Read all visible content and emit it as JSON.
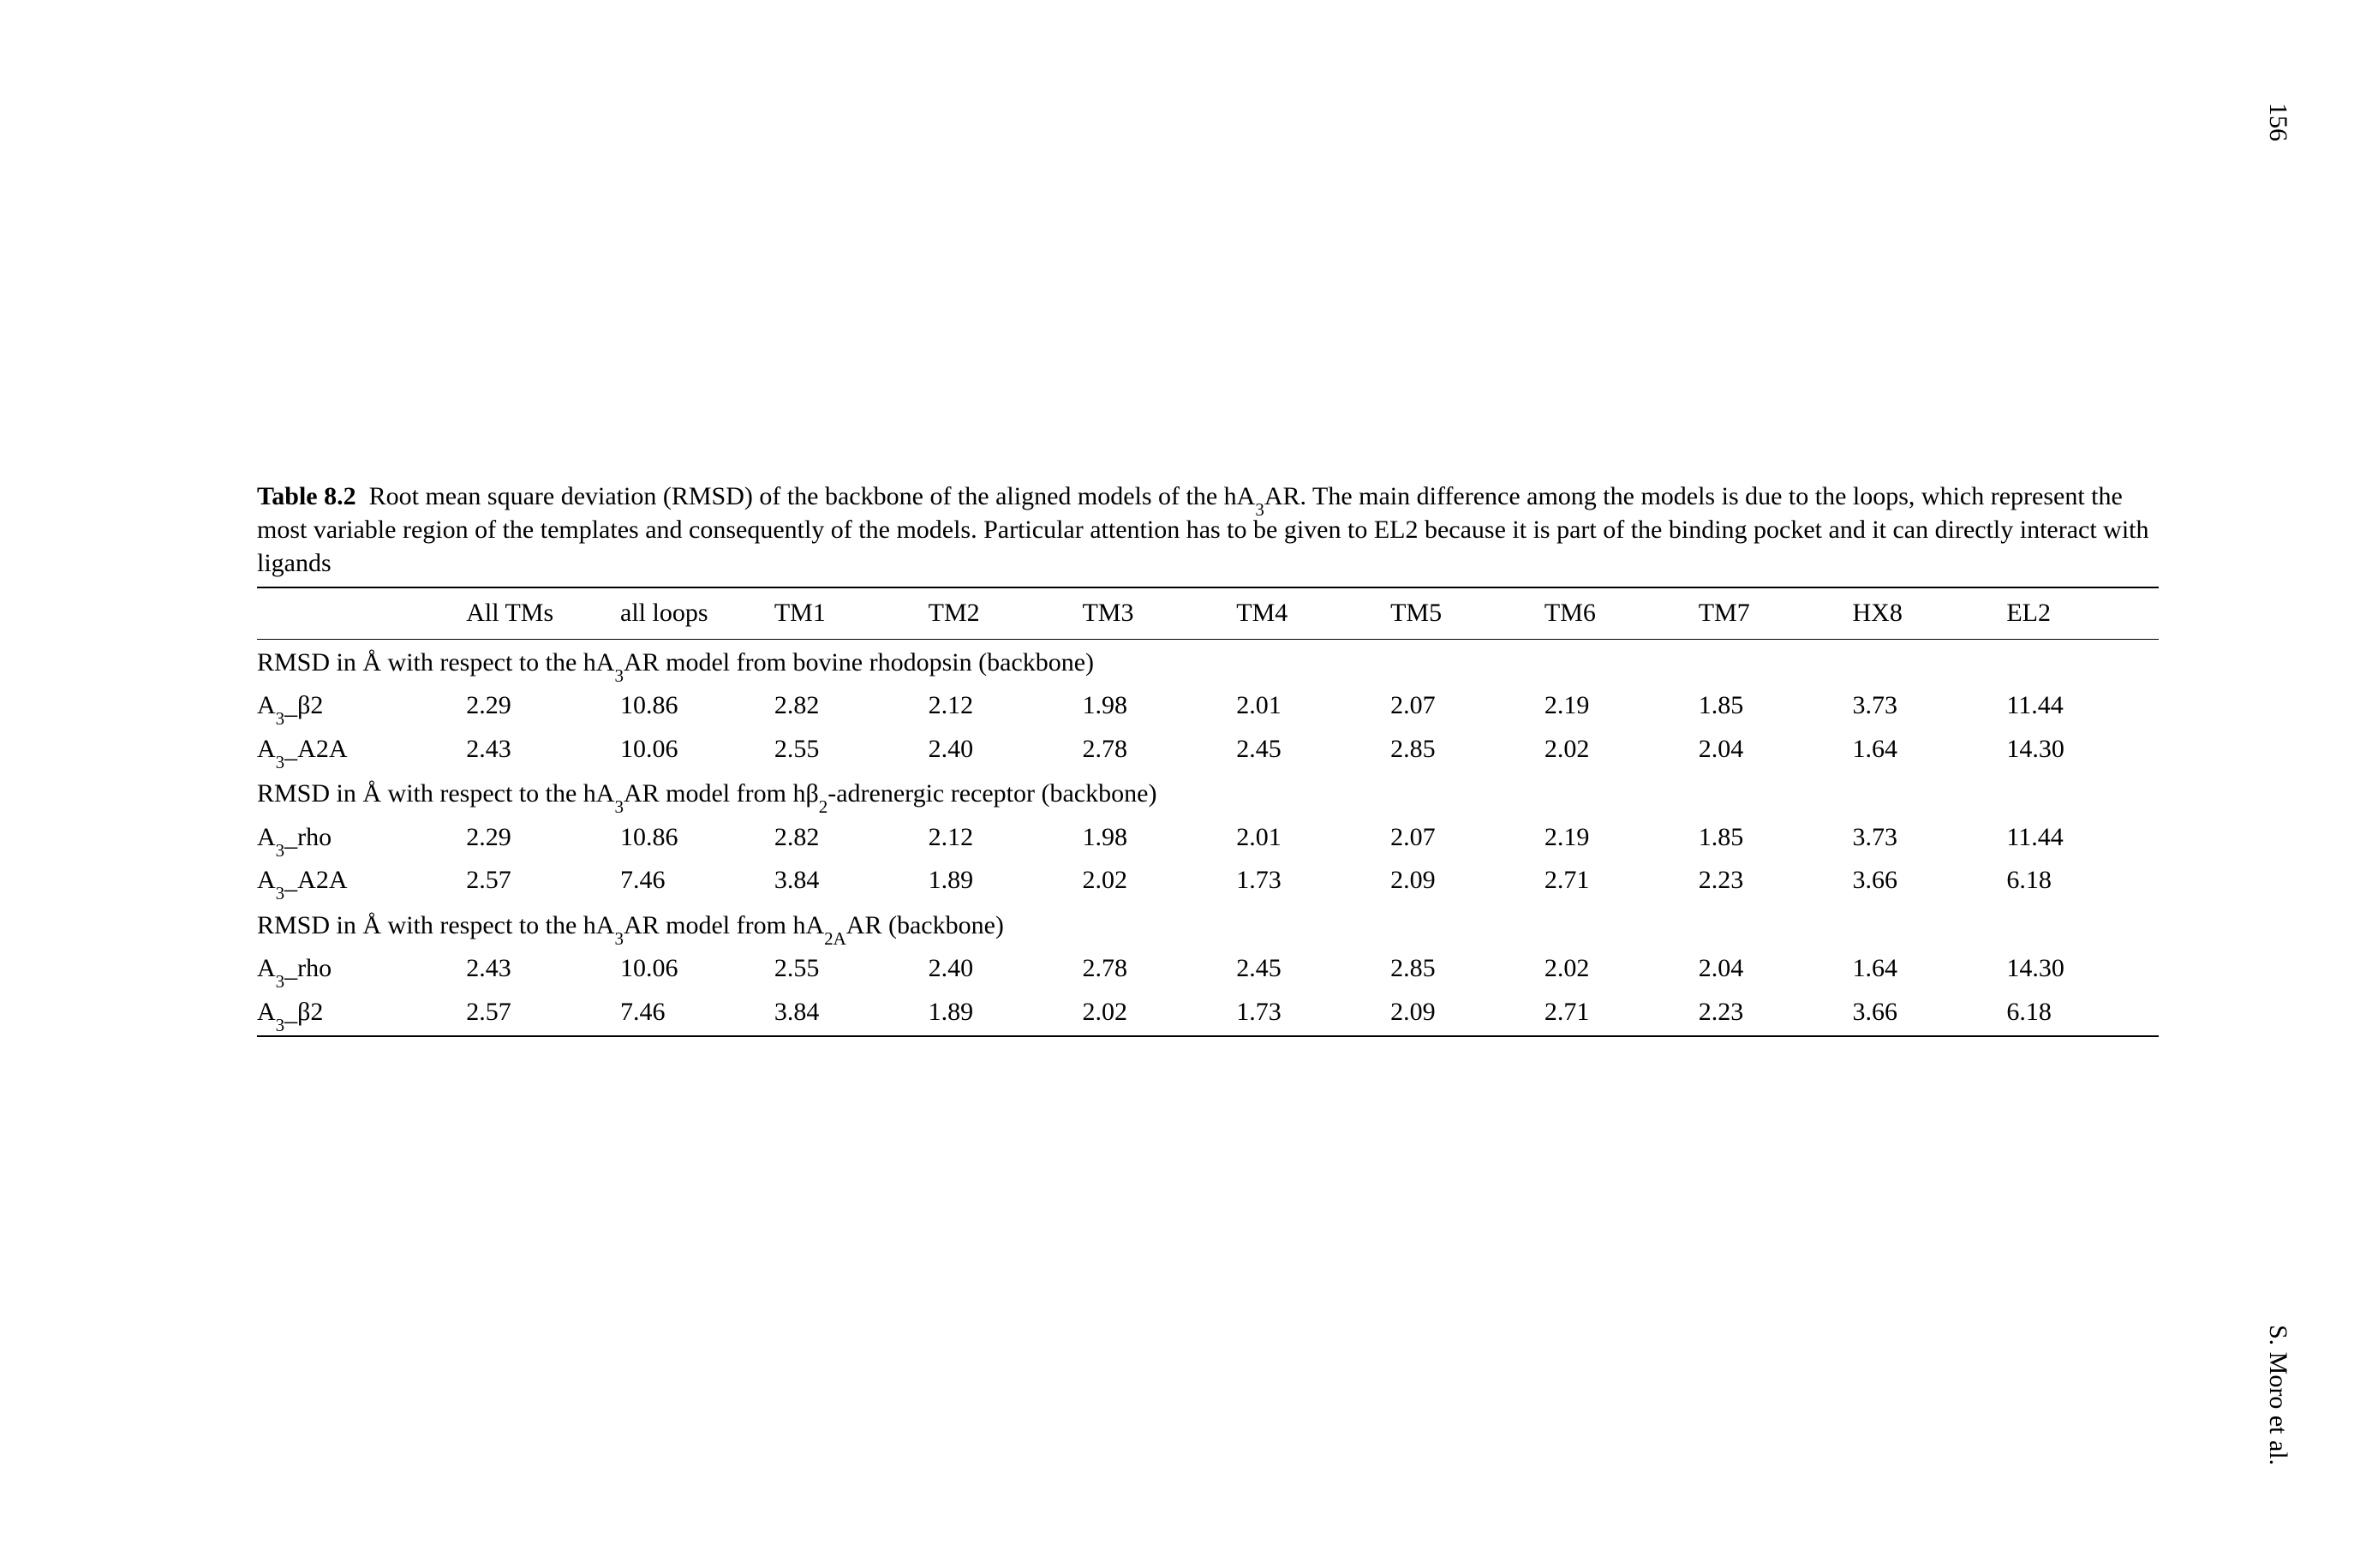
{
  "page_number": "156",
  "author": "S. Moro et al.",
  "caption_label": "Table 8.2",
  "caption_text": "Root mean square deviation (RMSD) of the backbone of the aligned models of the hA₃AR. The main difference among the models is due to the loops, which represent the most variable region of the templates and consequently of the models. Particular attention has to be given to EL2 because it is part of the binding pocket and it can directly interact with ligands",
  "headers": [
    "",
    "All TMs",
    "all loops",
    "TM1",
    "TM2",
    "TM3",
    "TM4",
    "TM5",
    "TM6",
    "TM7",
    "HX8",
    "EL2"
  ],
  "sections": [
    {
      "title": "RMSD in Å with respect to the hA₃AR model from bovine rhodopsin (backbone)",
      "rows": [
        {
          "label": "A₃_β2",
          "vals": [
            "2.29",
            "10.86",
            "2.82",
            "2.12",
            "1.98",
            "2.01",
            "2.07",
            "2.19",
            "1.85",
            "3.73",
            "11.44"
          ]
        },
        {
          "label": "A₃_A2A",
          "vals": [
            "2.43",
            "10.06",
            "2.55",
            "2.40",
            "2.78",
            "2.45",
            "2.85",
            "2.02",
            "2.04",
            "1.64",
            "14.30"
          ]
        }
      ]
    },
    {
      "title": "RMSD in Å with respect to the hA₃AR model from hβ₂-adrenergic receptor (backbone)",
      "rows": [
        {
          "label": "A₃_rho",
          "vals": [
            "2.29",
            "10.86",
            "2.82",
            "2.12",
            "1.98",
            "2.01",
            "2.07",
            "2.19",
            "1.85",
            "3.73",
            "11.44"
          ]
        },
        {
          "label": "A₃_A2A",
          "vals": [
            "2.57",
            "7.46",
            "3.84",
            "1.89",
            "2.02",
            "1.73",
            "2.09",
            "2.71",
            "2.23",
            "3.66",
            "6.18"
          ]
        }
      ]
    },
    {
      "title": "RMSD in Å with respect to the hA₃AR model from hA₂ₐAR (backbone)",
      "rows": [
        {
          "label": "A₃_rho",
          "vals": [
            "2.43",
            "10.06",
            "2.55",
            "2.40",
            "2.78",
            "2.45",
            "2.85",
            "2.02",
            "2.04",
            "1.64",
            "14.30"
          ]
        },
        {
          "label": "A₃_β2",
          "vals": [
            "2.57",
            "7.46",
            "3.84",
            "1.89",
            "2.02",
            "1.73",
            "2.09",
            "2.71",
            "2.23",
            "3.66",
            "6.18"
          ]
        }
      ]
    }
  ],
  "chart_data": {
    "type": "table",
    "title": "Table 8.2 RMSD (Å) of aligned hA3AR models",
    "columns": [
      "All TMs",
      "all loops",
      "TM1",
      "TM2",
      "TM3",
      "TM4",
      "TM5",
      "TM6",
      "TM7",
      "HX8",
      "EL2"
    ],
    "groups": [
      {
        "reference": "bovine rhodopsin",
        "rows": {
          "A3_β2": [
            2.29,
            10.86,
            2.82,
            2.12,
            1.98,
            2.01,
            2.07,
            2.19,
            1.85,
            3.73,
            11.44
          ],
          "A3_A2A": [
            2.43,
            10.06,
            2.55,
            2.4,
            2.78,
            2.45,
            2.85,
            2.02,
            2.04,
            1.64,
            14.3
          ]
        }
      },
      {
        "reference": "hβ2-adrenergic receptor",
        "rows": {
          "A3_rho": [
            2.29,
            10.86,
            2.82,
            2.12,
            1.98,
            2.01,
            2.07,
            2.19,
            1.85,
            3.73,
            11.44
          ],
          "A3_A2A": [
            2.57,
            7.46,
            3.84,
            1.89,
            2.02,
            1.73,
            2.09,
            2.71,
            2.23,
            3.66,
            6.18
          ]
        }
      },
      {
        "reference": "hA2A AR",
        "rows": {
          "A3_rho": [
            2.43,
            10.06,
            2.55,
            2.4,
            2.78,
            2.45,
            2.85,
            2.02,
            2.04,
            1.64,
            14.3
          ],
          "A3_β2": [
            2.57,
            7.46,
            3.84,
            1.89,
            2.02,
            1.73,
            2.09,
            2.71,
            2.23,
            3.66,
            6.18
          ]
        }
      }
    ]
  }
}
